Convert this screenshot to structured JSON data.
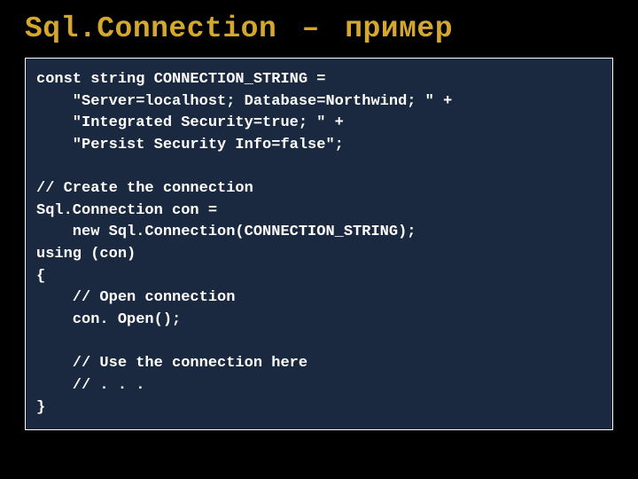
{
  "title": {
    "part1": "Sql.Connection",
    "separator": "–",
    "part2": "пример"
  },
  "code": {
    "line1": "const string CONNECTION_STRING =",
    "line2": "    \"Server=localhost; Database=Northwind; \" +",
    "line3": "    \"Integrated Security=true; \" +",
    "line4": "    \"Persist Security Info=false\";",
    "line5": "",
    "line6": "// Create the connection",
    "line7": "Sql.Connection con =",
    "line8": "    new Sql.Connection(CONNECTION_STRING);",
    "line9": "using (con)",
    "line10": "{",
    "line11": "    // Open connection",
    "line12": "    con. Open();",
    "line13": "",
    "line14": "    // Use the connection here",
    "line15": "    // . . .",
    "line16": "}"
  }
}
